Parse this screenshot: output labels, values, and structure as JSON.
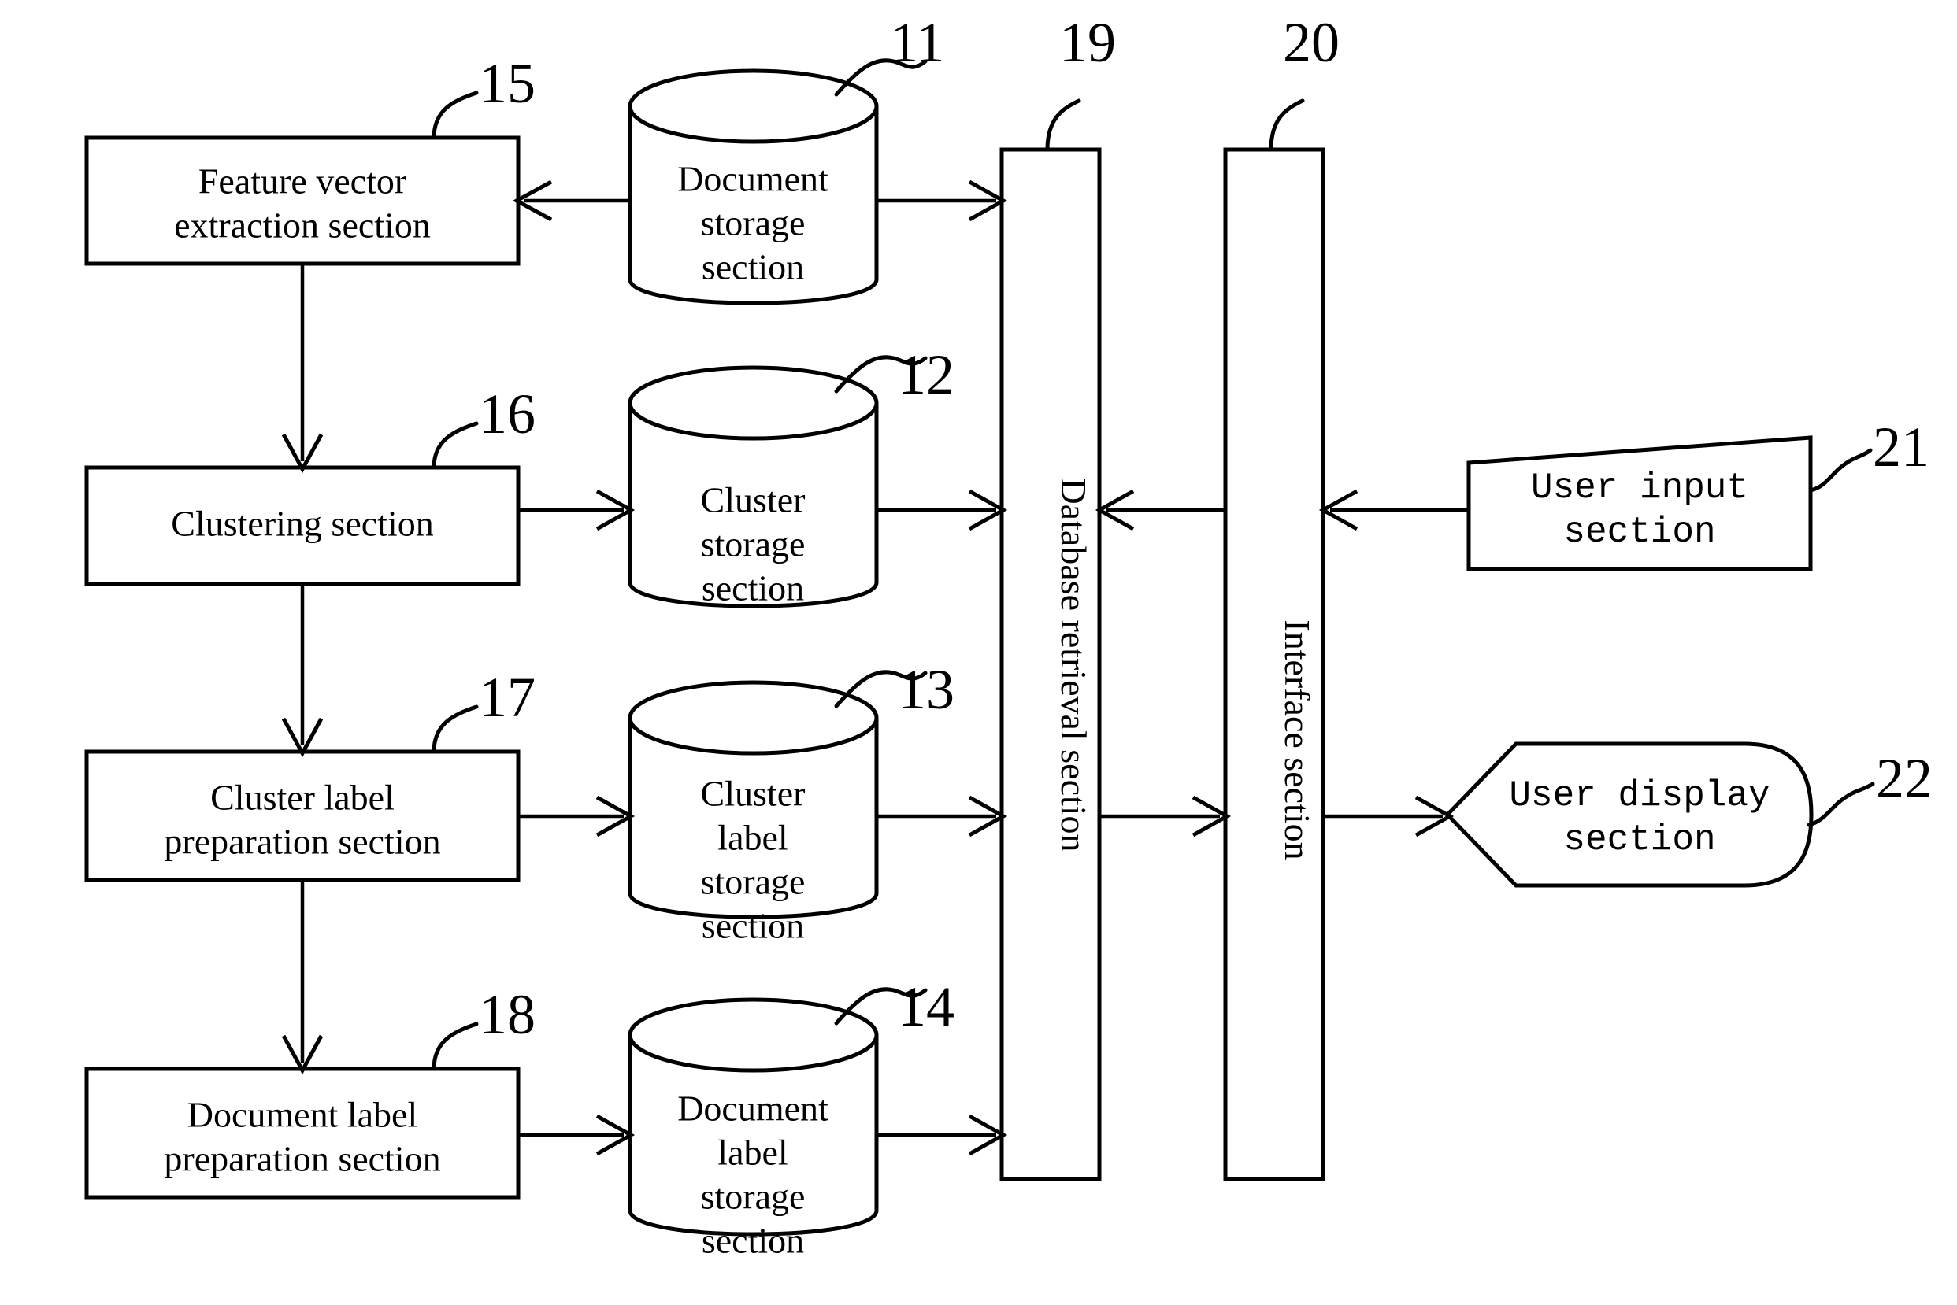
{
  "figure": {
    "type": "patent-block-diagram",
    "background": "#ffffff",
    "line_color": "#000000"
  },
  "blocks": {
    "feature_vector": {
      "ref": "15",
      "line1": "Feature vector",
      "line2": "extraction section",
      "shape": "rectangle"
    },
    "clustering": {
      "ref": "16",
      "line1": "Clustering section",
      "line2": "",
      "shape": "rectangle"
    },
    "cluster_label_prep": {
      "ref": "17",
      "line1": "Cluster label",
      "line2": "preparation section",
      "shape": "rectangle"
    },
    "document_label_prep": {
      "ref": "18",
      "line1": "Document label",
      "line2": "preparation section",
      "shape": "rectangle"
    },
    "document_storage": {
      "ref": "11",
      "line1": "Document",
      "line2": "storage",
      "line3": "section",
      "shape": "cylinder"
    },
    "cluster_storage": {
      "ref": "12",
      "line1": "Cluster",
      "line2": "storage",
      "line3": "section",
      "shape": "cylinder"
    },
    "cluster_label_storage": {
      "ref": "13",
      "line1": "Cluster",
      "line2": "label",
      "line3": "storage",
      "line4": "section",
      "shape": "cylinder"
    },
    "document_label_storage": {
      "ref": "14",
      "line1": "Document",
      "line2": "label",
      "line3": "storage",
      "line4": "section",
      "shape": "cylinder"
    },
    "database_retrieval": {
      "ref": "19",
      "label": "Database retrieval section",
      "shape": "tall-rectangle",
      "orientation": "vertical-text"
    },
    "interface": {
      "ref": "20",
      "label": "Interface section",
      "shape": "tall-rectangle",
      "orientation": "vertical-text"
    },
    "user_input": {
      "ref": "21",
      "line1": "User input",
      "line2": "section",
      "shape": "trapezoid"
    },
    "user_display": {
      "ref": "22",
      "line1": "User display",
      "line2": "section",
      "shape": "display"
    }
  },
  "connections": [
    {
      "name": "document-storage-to-feature-vector",
      "from": "document_storage",
      "to": "feature_vector",
      "direction": "left"
    },
    {
      "name": "document-storage-to-database-retrieval",
      "from": "document_storage",
      "to": "database_retrieval",
      "direction": "right"
    },
    {
      "name": "feature-vector-to-clustering",
      "from": "feature_vector",
      "to": "clustering",
      "direction": "down"
    },
    {
      "name": "clustering-to-cluster-storage",
      "from": "clustering",
      "to": "cluster_storage",
      "direction": "right"
    },
    {
      "name": "cluster-storage-to-database-retrieval",
      "from": "cluster_storage",
      "to": "database_retrieval",
      "direction": "right"
    },
    {
      "name": "clustering-to-cluster-label-prep",
      "from": "clustering",
      "to": "cluster_label_prep",
      "direction": "down"
    },
    {
      "name": "cluster-label-prep-to-cluster-label-storage",
      "from": "cluster_label_prep",
      "to": "cluster_label_storage",
      "direction": "right"
    },
    {
      "name": "cluster-label-storage-to-database-retrieval",
      "from": "cluster_label_storage",
      "to": "database_retrieval",
      "direction": "right"
    },
    {
      "name": "cluster-label-prep-to-document-label-prep",
      "from": "cluster_label_prep",
      "to": "document_label_prep",
      "direction": "down"
    },
    {
      "name": "document-label-prep-to-document-label-storage",
      "from": "document_label_prep",
      "to": "document_label_storage",
      "direction": "right"
    },
    {
      "name": "document-label-storage-to-database-retrieval",
      "from": "document_label_storage",
      "to": "database_retrieval",
      "direction": "right"
    },
    {
      "name": "interface-to-database-retrieval",
      "from": "interface",
      "to": "database_retrieval",
      "direction": "left"
    },
    {
      "name": "user-input-to-interface",
      "from": "user_input",
      "to": "interface",
      "direction": "left"
    },
    {
      "name": "database-retrieval-to-interface",
      "from": "database_retrieval",
      "to": "interface",
      "direction": "right"
    },
    {
      "name": "interface-to-user-display",
      "from": "interface",
      "to": "user_display",
      "direction": "right"
    }
  ]
}
